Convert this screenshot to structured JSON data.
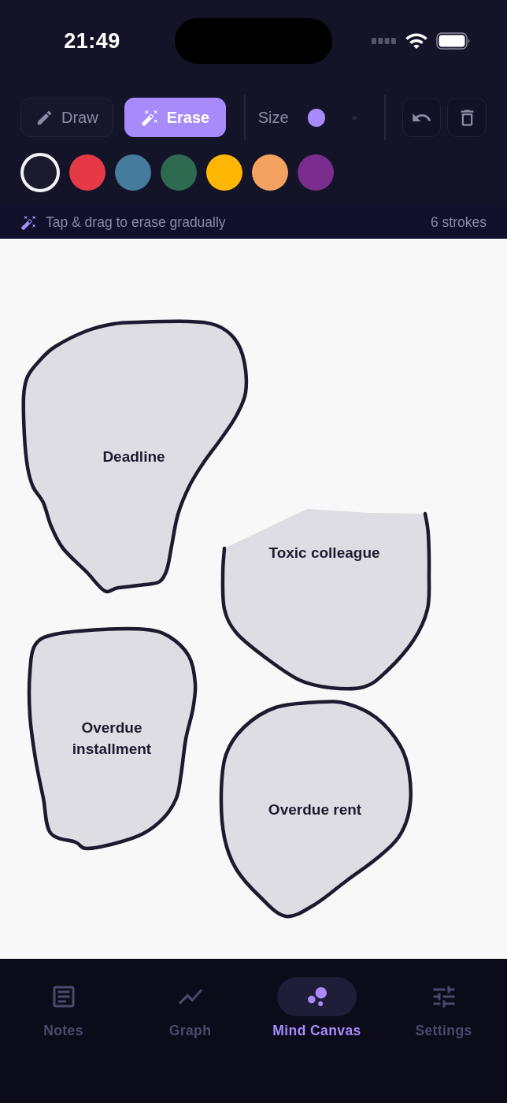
{
  "status_bar": {
    "time": "21:49"
  },
  "toolbar": {
    "modes": [
      {
        "kind": "draw",
        "label": "Draw",
        "selected": false
      },
      {
        "kind": "erase",
        "label": "Erase",
        "selected": true
      }
    ],
    "size": {
      "label": "Size",
      "options": [
        {
          "selected": true
        },
        {
          "selected": false
        }
      ]
    },
    "colors": [
      {
        "color": "#1b1b2e",
        "selected": true
      },
      {
        "color": "#e63946",
        "selected": false
      },
      {
        "color": "#457b9d",
        "selected": false
      },
      {
        "color": "#2d6a4f",
        "selected": false
      },
      {
        "color": "#ffb703",
        "selected": false
      },
      {
        "color": "#f4a261",
        "selected": false
      },
      {
        "color": "#7b2d8e",
        "selected": false
      }
    ]
  },
  "hint": {
    "text": "Tap & drag to erase gradually",
    "count": "6 strokes"
  },
  "canvas": {
    "blobs": [
      {
        "label": "Deadline",
        "erased": false
      },
      {
        "label": "Toxic colleague",
        "erased": true
      },
      {
        "label": "Overdue installment",
        "erased": false
      },
      {
        "label": "Overdue rent",
        "erased": false
      }
    ]
  },
  "tab_bar": {
    "tabs": [
      {
        "kind": "notes",
        "label": "Notes",
        "selected": false
      },
      {
        "kind": "graph",
        "label": "Graph",
        "selected": false
      },
      {
        "kind": "canvas",
        "label": "Mind Canvas",
        "selected": true
      },
      {
        "kind": "settings",
        "label": "Settings",
        "selected": false
      }
    ]
  }
}
